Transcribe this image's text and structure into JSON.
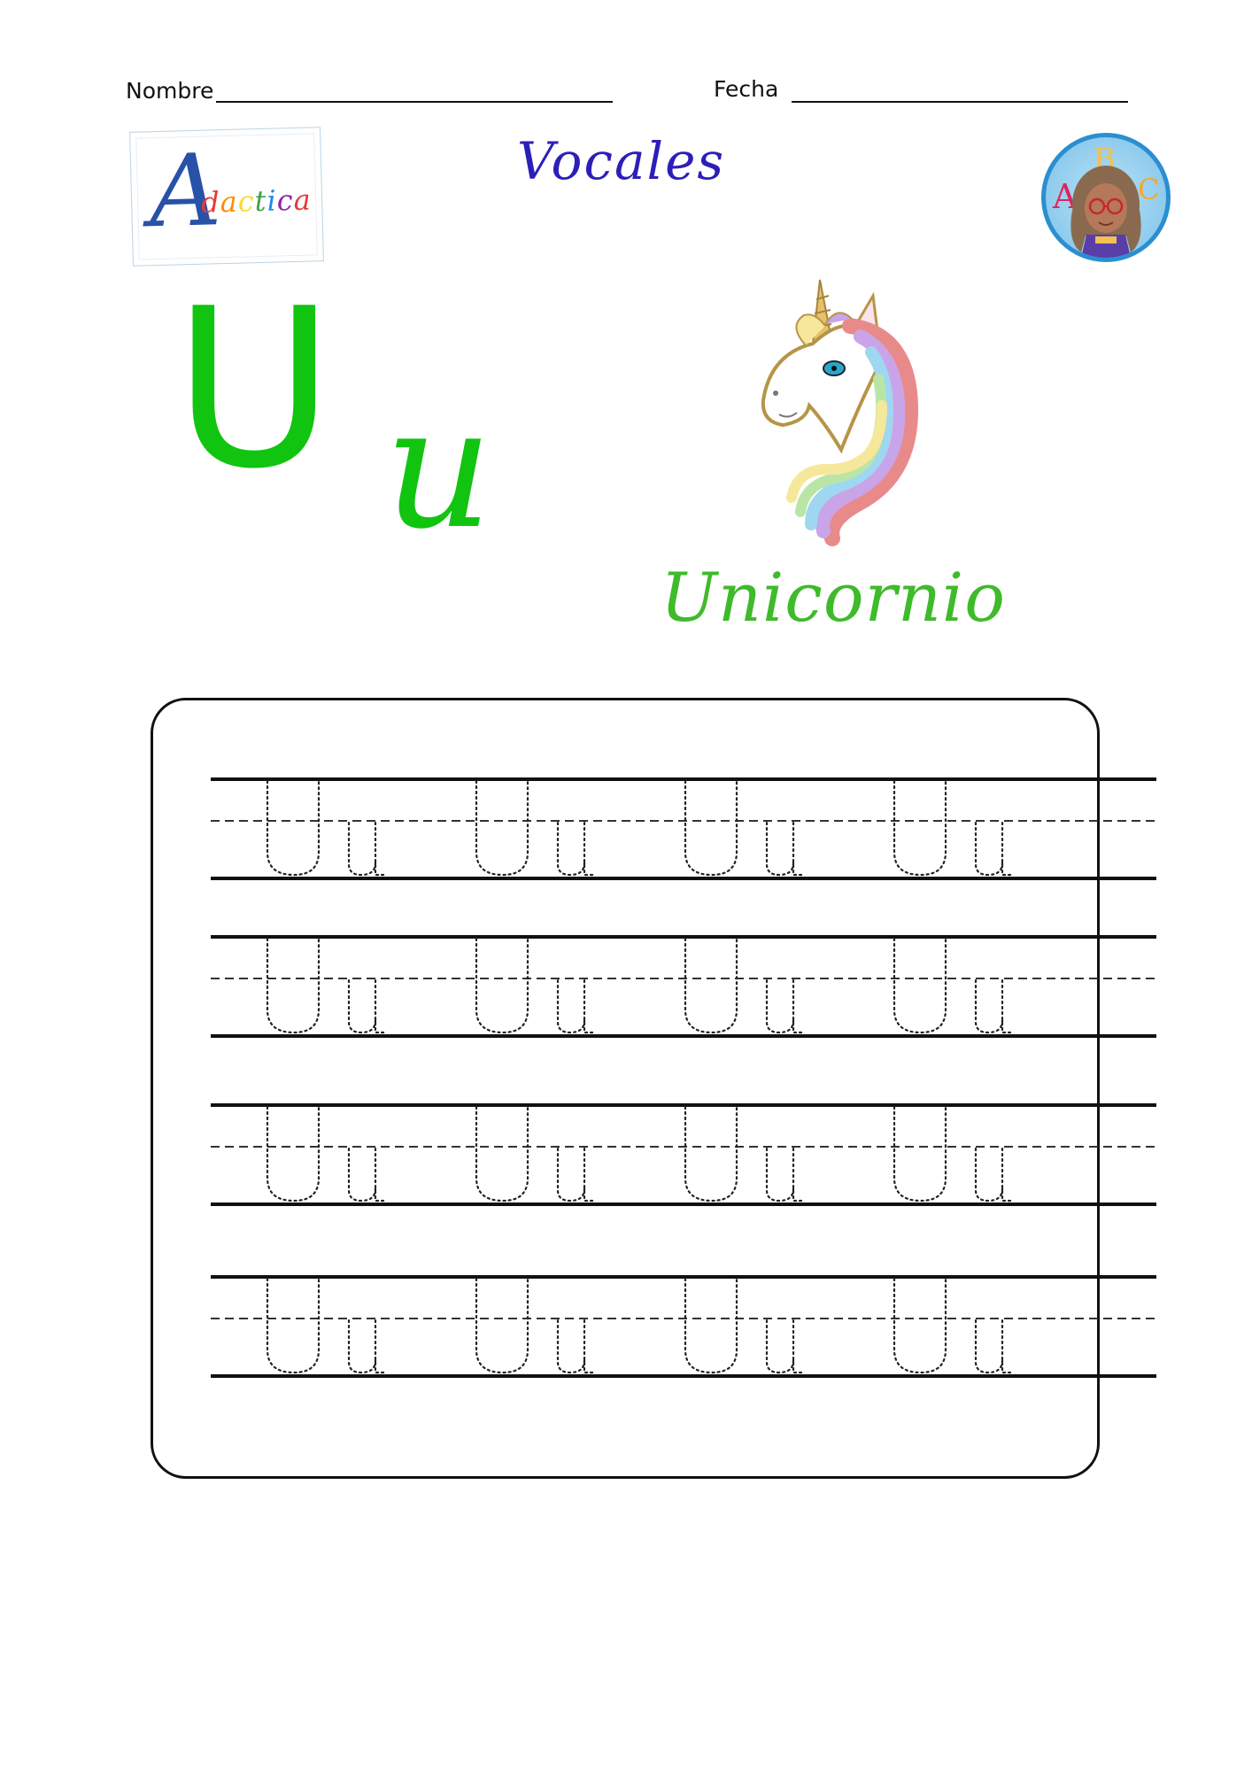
{
  "header": {
    "name_label": "Nombre",
    "date_label": "Fecha"
  },
  "title": "Vocales",
  "logo": {
    "initial": "A",
    "text": "dactica"
  },
  "avatar": {
    "letters": [
      "A",
      "B",
      "C"
    ]
  },
  "letters": {
    "upper": "U",
    "lower": "u"
  },
  "word": "Unicornio",
  "practice": {
    "rows": 4,
    "pairs_per_row": 4,
    "trace_text": "Uu"
  },
  "colors": {
    "title": "#2c1fb8",
    "letters": "#11c410",
    "word": "#3fba2b",
    "logo_rainbow": [
      "#e53935",
      "#fb8c00",
      "#fdd835",
      "#43a047",
      "#1e88e5",
      "#8e24aa"
    ]
  }
}
